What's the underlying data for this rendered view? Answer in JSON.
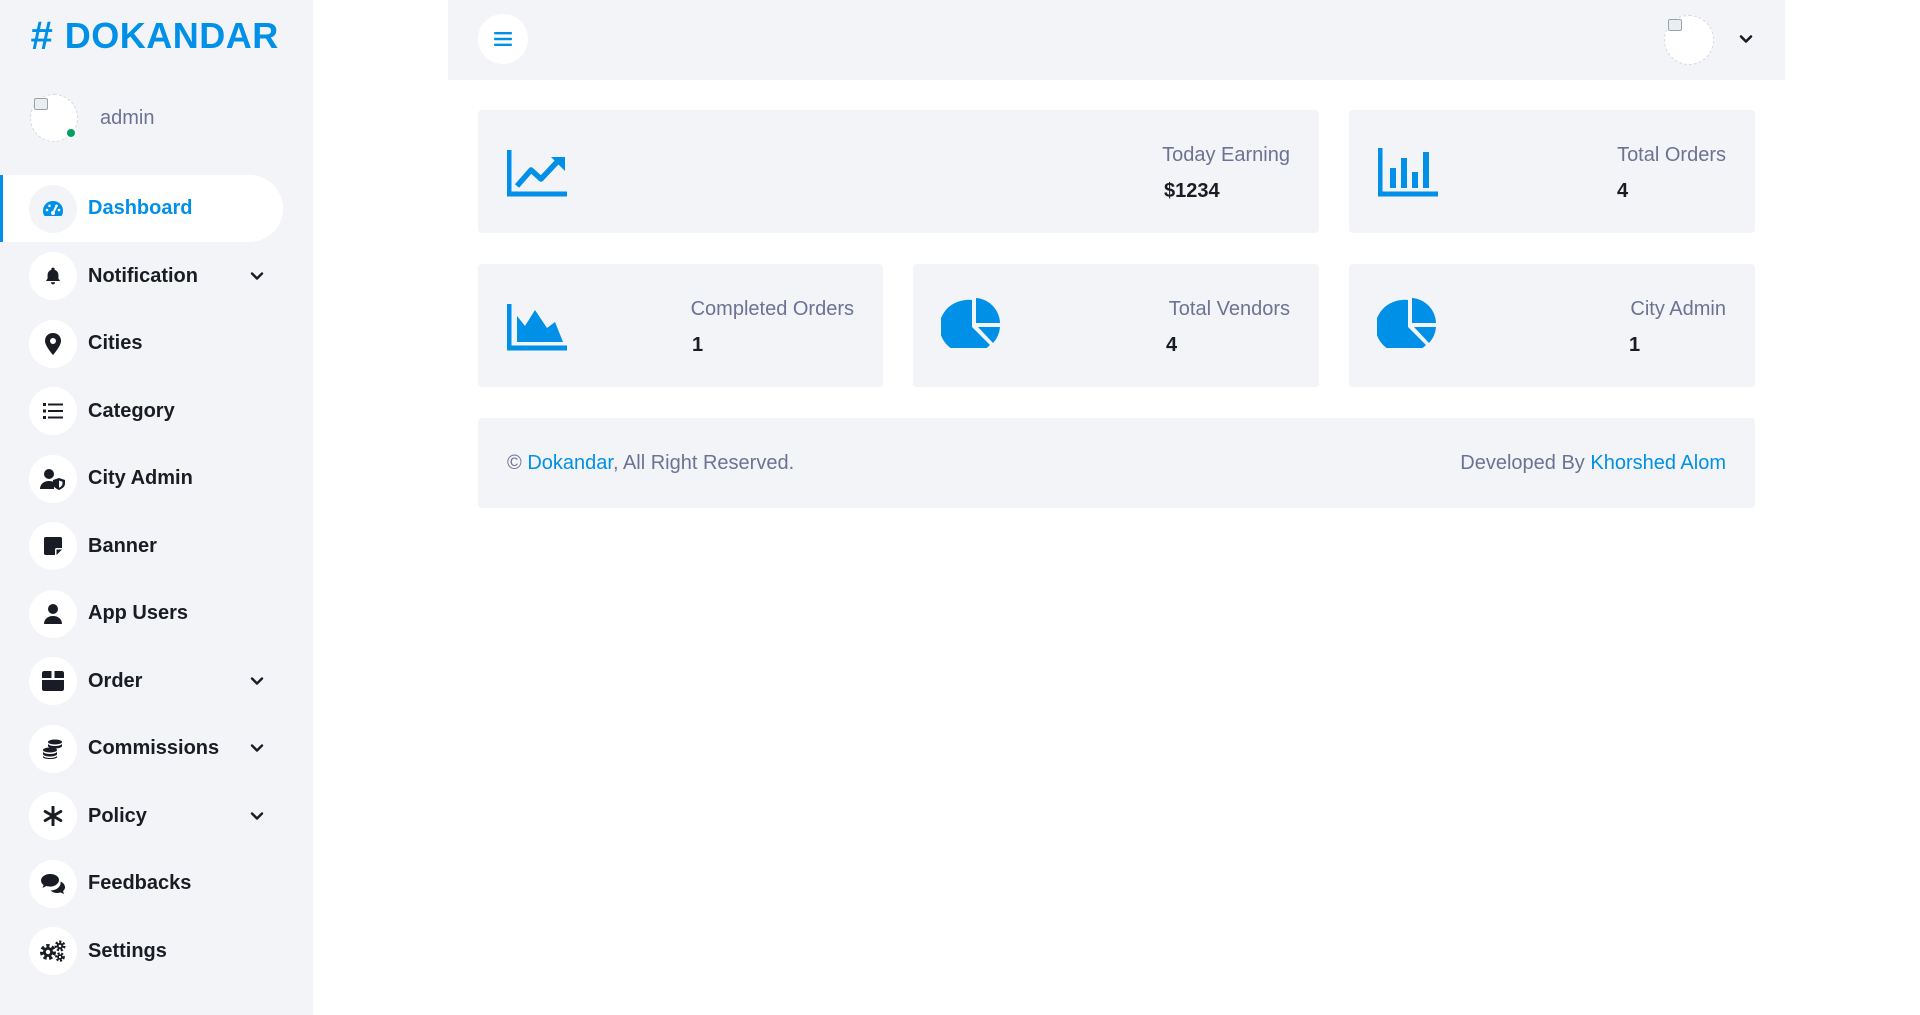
{
  "brand": {
    "name": "DOKANDAR",
    "symbol": "#"
  },
  "profile": {
    "name": "admin"
  },
  "sidebar": {
    "items": [
      {
        "label": "Dashboard",
        "icon": "speedometer-icon"
      },
      {
        "label": "Notification",
        "icon": "bell-icon"
      },
      {
        "label": "Cities",
        "icon": "map-pin-icon"
      },
      {
        "label": "Category",
        "icon": "list-icon"
      },
      {
        "label": "City Admin",
        "icon": "user-shield-icon"
      },
      {
        "label": "Banner",
        "icon": "sticky-note-icon"
      },
      {
        "label": "App Users",
        "icon": "user-icon"
      },
      {
        "label": "Order",
        "icon": "box-icon"
      },
      {
        "label": "Commissions",
        "icon": "coins-icon"
      },
      {
        "label": "Policy",
        "icon": "asterisk-icon"
      },
      {
        "label": "Feedbacks",
        "icon": "comments-icon"
      },
      {
        "label": "Settings",
        "icon": "gears-icon"
      }
    ]
  },
  "stats": {
    "today_earning": {
      "title": "Today Earning",
      "value": "$1234",
      "icon": "chart-line-icon"
    },
    "total_orders": {
      "title": "Total Orders",
      "value": "4",
      "icon": "chart-bar-icon"
    },
    "completed_orders": {
      "title": "Completed Orders",
      "value": "1",
      "icon": "chart-area-icon"
    },
    "total_vendors": {
      "title": "Total Vendors",
      "value": "4",
      "icon": "chart-pie-icon"
    },
    "city_admin": {
      "title": "City Admin",
      "value": "1",
      "icon": "chart-pie-icon"
    }
  },
  "footer": {
    "copyright_symbol": "©",
    "brand_link": "Dokandar",
    "rights": ", All Right Reserved.",
    "developed_by": "Developed By",
    "developer_link": "Khorshed Alom"
  },
  "colors": {
    "accent": "#0090e7",
    "panel": "#f2f4f7",
    "text": "#191c24",
    "muted": "#6c7293",
    "online": "#00a15e"
  }
}
